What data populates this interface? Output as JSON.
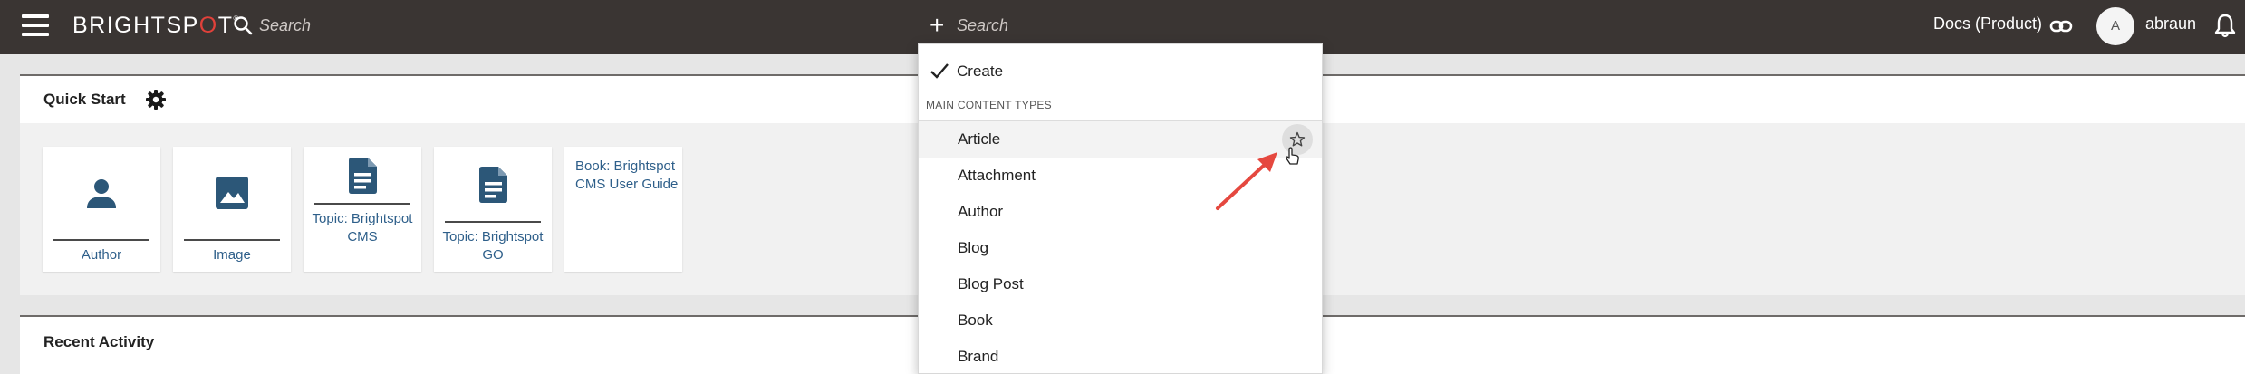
{
  "header": {
    "logo_text_prefix": "BRIGHTSP",
    "logo_text_o": "O",
    "logo_text_suffix": "T",
    "logo_tm": "®",
    "search_placeholder": "Search",
    "create_search_placeholder": "Search",
    "create_plus": "+",
    "site_label": "Docs (Product)",
    "avatar_initial": "A",
    "username": "abraun"
  },
  "quick_start": {
    "title": "Quick Start",
    "tiles": [
      {
        "label": "Author",
        "icon": "person-icon"
      },
      {
        "label": "Image",
        "icon": "image-icon"
      },
      {
        "label": "Topic: Brightspot CMS",
        "icon": "document-icon"
      },
      {
        "label": "Topic: Brightspot GO",
        "icon": "document-icon"
      },
      {
        "label": "Book: Brightspot CMS User Guide",
        "icon": ""
      }
    ]
  },
  "recent_activity": {
    "title": "Recent Activity"
  },
  "create_menu": {
    "create_label": "Create",
    "section_label": "MAIN CONTENT TYPES",
    "items": [
      {
        "label": "Article",
        "hovered": true
      },
      {
        "label": "Attachment"
      },
      {
        "label": "Author"
      },
      {
        "label": "Blog"
      },
      {
        "label": "Blog Post"
      },
      {
        "label": "Book"
      },
      {
        "label": "Brand"
      }
    ]
  },
  "colors": {
    "topbar": "#3a3533",
    "link_blue": "#2e5f8a",
    "tile_icon": "#2c5778",
    "logo_accent": "#e0413a",
    "annotation_arrow": "#e5483f"
  }
}
